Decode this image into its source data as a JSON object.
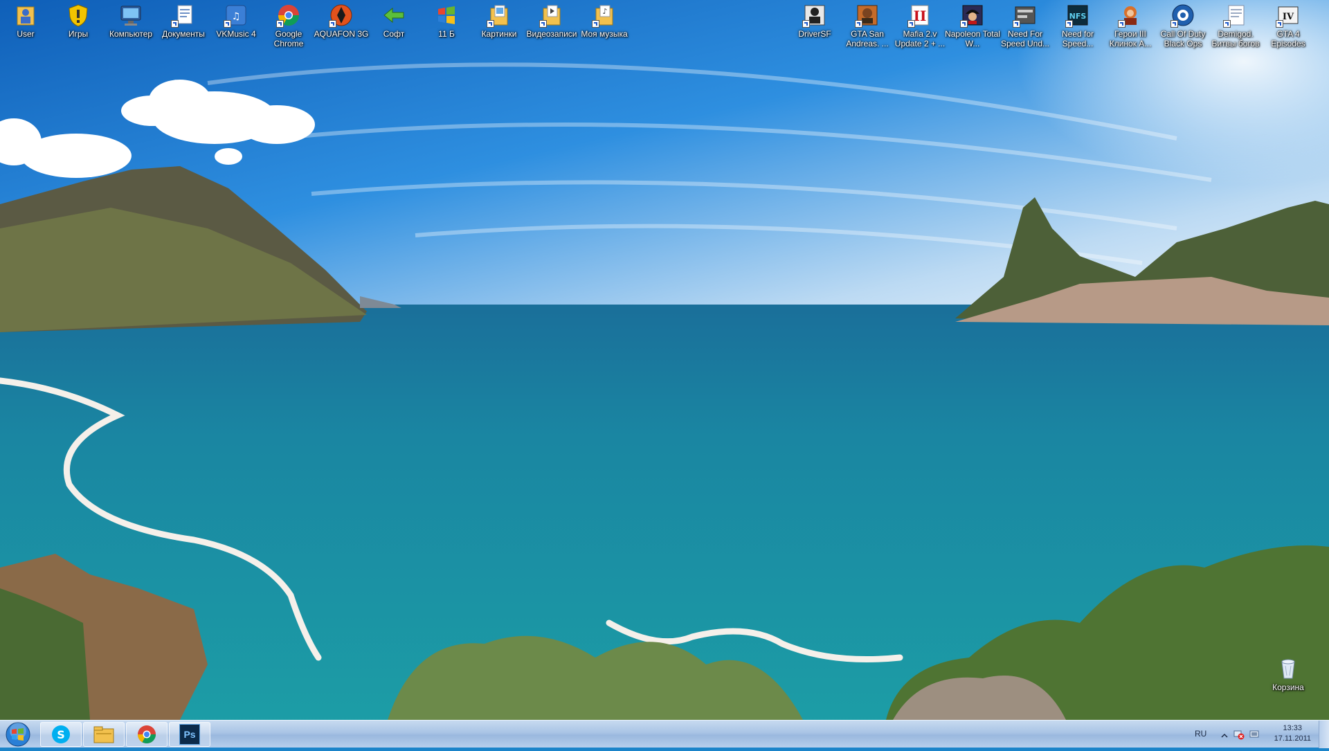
{
  "desktop": {
    "icons_left": [
      {
        "label": "User",
        "icon": "user-folder-icon"
      },
      {
        "label": "Игры",
        "icon": "games-shield-icon"
      },
      {
        "label": "Компьютер",
        "icon": "computer-icon"
      },
      {
        "label": "Документы",
        "icon": "documents-icon"
      },
      {
        "label": "VKMusic 4",
        "icon": "vkmusic-icon"
      },
      {
        "label": "Google Chrome",
        "icon": "chrome-icon"
      },
      {
        "label": "AQUAFON 3G",
        "icon": "aquafon-icon"
      },
      {
        "label": "Софт",
        "icon": "soft-arrow-icon"
      },
      {
        "label": "11 Б",
        "icon": "windows-flag-icon"
      },
      {
        "label": "Картинки",
        "icon": "pictures-folder-icon"
      },
      {
        "label": "Видеозаписи",
        "icon": "videos-folder-icon"
      },
      {
        "label": "Моя музыка",
        "icon": "music-folder-icon"
      }
    ],
    "icons_right": [
      {
        "label": "DriverSF",
        "icon": "driver-game-icon"
      },
      {
        "label": "GTA San Andreas. ...",
        "icon": "gta-sa-icon"
      },
      {
        "label": "Mafia 2.v Update 2 + ...",
        "icon": "mafia2-icon"
      },
      {
        "label": "Napoleon Total W...",
        "icon": "napoleon-icon"
      },
      {
        "label": "Need For Speed Und...",
        "icon": "nfs-underground-icon"
      },
      {
        "label": "Need for Speed...",
        "icon": "nfs-icon"
      },
      {
        "label": "Герои III Клинок А...",
        "icon": "heroes3-icon"
      },
      {
        "label": "Call Of Duty Black Ops",
        "icon": "cod-black-ops-icon"
      },
      {
        "label": "Demigod. Битвы богов",
        "icon": "demigod-icon"
      },
      {
        "label": "GTA 4 Episodes",
        "icon": "gta4-icon"
      }
    ],
    "recycle_bin": {
      "label": "Корзина",
      "icon": "recycle-bin-icon"
    }
  },
  "taskbar": {
    "pinned": [
      {
        "name": "skype",
        "icon": "skype-icon"
      },
      {
        "name": "explorer",
        "icon": "folder-icon"
      },
      {
        "name": "chrome",
        "icon": "chrome-icon"
      },
      {
        "name": "photoshop",
        "icon": "photoshop-icon",
        "text": "Ps"
      }
    ],
    "tray": {
      "language": "RU",
      "time": "13:33",
      "date": "17.11.2011"
    }
  },
  "colors": {
    "sky_top": "#1a73c8",
    "sea": "#1b8aa0",
    "taskbar": "#b3cbe8"
  }
}
